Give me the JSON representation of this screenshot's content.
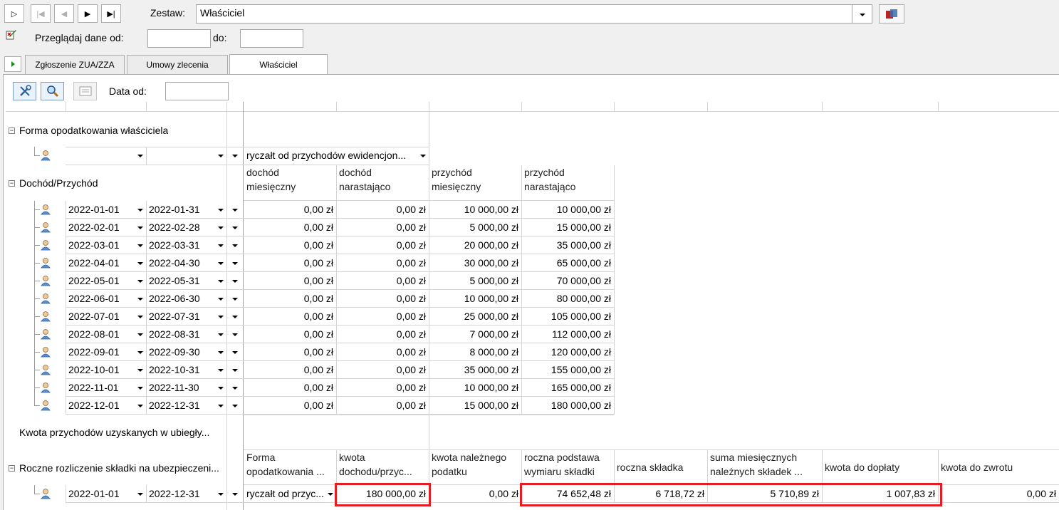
{
  "toolbar": {
    "zestaw_label": "Zestaw:",
    "zestaw_value": "Właściciel",
    "przegladaj_label": "Przeglądaj dane od:",
    "do_label": "do:",
    "od_value": "",
    "do_value": ""
  },
  "tabs": [
    {
      "label": "Zgłoszenie ZUA/ZZA"
    },
    {
      "label": "Umowy zlecenia"
    },
    {
      "label": "Właściciel"
    }
  ],
  "panel": {
    "data_od_label": "Data od:",
    "data_od_value": ""
  },
  "sections": {
    "forma": "Forma opodatkowania właściciela",
    "forma_value": "ryczałt od przychodów ewidencjon...",
    "dochod": "Dochód/Przychód",
    "kwota_prev": "Kwota przychodów uzyskanych w ubiegły...",
    "roczne": "Roczne rozliczenie składki na ubezpieczeni..."
  },
  "income_headers": [
    "dochód\nmiesięczny",
    "dochód\nnarastająco",
    "przychód\nmiesięczny",
    "przychód\nnarastająco"
  ],
  "income_rows": [
    {
      "from": "2022-01-01",
      "to": "2022-01-31",
      "d_m": "0,00 zł",
      "d_n": "0,00 zł",
      "p_m": "10 000,00 zł",
      "p_n": "10 000,00 zł"
    },
    {
      "from": "2022-02-01",
      "to": "2022-02-28",
      "d_m": "0,00 zł",
      "d_n": "0,00 zł",
      "p_m": "5 000,00 zł",
      "p_n": "15 000,00 zł"
    },
    {
      "from": "2022-03-01",
      "to": "2022-03-31",
      "d_m": "0,00 zł",
      "d_n": "0,00 zł",
      "p_m": "20 000,00 zł",
      "p_n": "35 000,00 zł"
    },
    {
      "from": "2022-04-01",
      "to": "2022-04-30",
      "d_m": "0,00 zł",
      "d_n": "0,00 zł",
      "p_m": "30 000,00 zł",
      "p_n": "65 000,00 zł"
    },
    {
      "from": "2022-05-01",
      "to": "2022-05-31",
      "d_m": "0,00 zł",
      "d_n": "0,00 zł",
      "p_m": "5 000,00 zł",
      "p_n": "70 000,00 zł"
    },
    {
      "from": "2022-06-01",
      "to": "2022-06-30",
      "d_m": "0,00 zł",
      "d_n": "0,00 zł",
      "p_m": "10 000,00 zł",
      "p_n": "80 000,00 zł"
    },
    {
      "from": "2022-07-01",
      "to": "2022-07-31",
      "d_m": "0,00 zł",
      "d_n": "0,00 zł",
      "p_m": "25 000,00 zł",
      "p_n": "105 000,00 zł"
    },
    {
      "from": "2022-08-01",
      "to": "2022-08-31",
      "d_m": "0,00 zł",
      "d_n": "0,00 zł",
      "p_m": "7 000,00 zł",
      "p_n": "112 000,00 zł"
    },
    {
      "from": "2022-09-01",
      "to": "2022-09-30",
      "d_m": "0,00 zł",
      "d_n": "0,00 zł",
      "p_m": "8 000,00 zł",
      "p_n": "120 000,00 zł"
    },
    {
      "from": "2022-10-01",
      "to": "2022-10-31",
      "d_m": "0,00 zł",
      "d_n": "0,00 zł",
      "p_m": "35 000,00 zł",
      "p_n": "155 000,00 zł"
    },
    {
      "from": "2022-11-01",
      "to": "2022-11-30",
      "d_m": "0,00 zł",
      "d_n": "0,00 zł",
      "p_m": "10 000,00 zł",
      "p_n": "165 000,00 zł"
    },
    {
      "from": "2022-12-01",
      "to": "2022-12-31",
      "d_m": "0,00 zł",
      "d_n": "0,00 zł",
      "p_m": "15 000,00 zł",
      "p_n": "180 000,00 zł"
    }
  ],
  "annual_headers": [
    "Forma\nopodatkowania ...",
    "kwota\ndochodu/przyc...",
    "kwota należnego\npodatku",
    "roczna podstawa\nwymiaru składki",
    "roczna składka",
    "suma miesięcznych\nnależnych składek ...",
    "kwota do dopłaty",
    "kwota do zwrotu"
  ],
  "annual_row": {
    "from": "2022-01-01",
    "to": "2022-12-31",
    "forma": "ryczałt od przyc...",
    "kwota_dochodu": "180 000,00 zł",
    "kwota_podatku": "0,00 zł",
    "podstawa": "74 652,48 zł",
    "skladka": "6 718,72 zł",
    "suma": "5 710,89 zł",
    "doplata": "1 007,83 zł",
    "zwrot": "0,00 zł"
  },
  "highlight_color": "#e51c23"
}
